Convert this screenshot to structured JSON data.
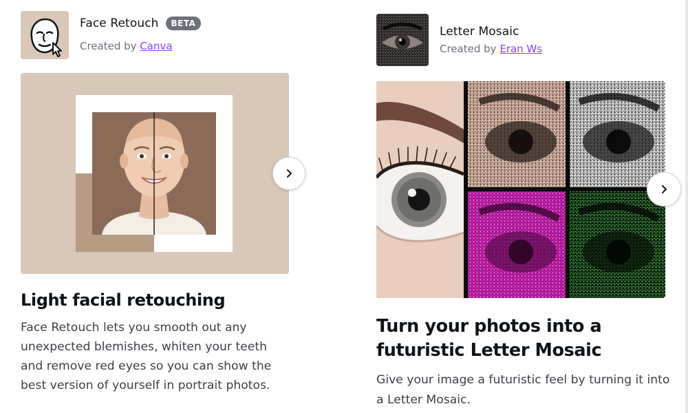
{
  "cards": [
    {
      "app_name": "Face Retouch",
      "badge": "BETA",
      "created_by_prefix": "Created by",
      "author": "Canva",
      "title": "Light facial retouching",
      "description": "Face Retouch lets you smooth out any unexpected blemishes, whiten your teeth and remove red eyes so you can show the best version of yourself in portrait photos.",
      "icon": "face-cursor-icon"
    },
    {
      "app_name": "Letter Mosaic",
      "created_by_prefix": "Created by",
      "author": "Eran Ws",
      "title": "Turn your photos into a futuristic Letter Mosaic",
      "description": "Give your image a futuristic feel by turning it into a Letter Mosaic.",
      "icon": "eye-mosaic-thumbnail"
    }
  ],
  "colors": {
    "accent_link": "#8b3dff",
    "badge_bg": "#6b7179",
    "face_card_bg": "#d9c7b7",
    "mosaic_magenta": "#c01fa9",
    "mosaic_green": "#2f7b30"
  }
}
